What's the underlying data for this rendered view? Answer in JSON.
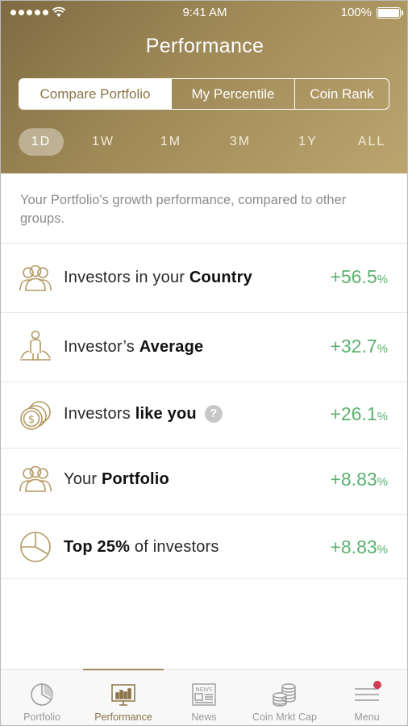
{
  "status_bar": {
    "time": "9:41 AM",
    "battery": "100%"
  },
  "header": {
    "title": "Performance",
    "segments": [
      "Compare Portfolio",
      "My Percentile",
      "Coin Rank"
    ],
    "active_segment": "Compare Portfolio",
    "ranges": [
      "1D",
      "1W",
      "1M",
      "3M",
      "1Y",
      "ALL"
    ],
    "active_range": "1D"
  },
  "description": "Your Portfolio's growth performance, compared to other groups.",
  "rows": [
    {
      "icon": "group-icon",
      "label_pre": "Investors in your ",
      "label_bold": "Country",
      "label_post": "",
      "value": "+56.5",
      "unit": "%"
    },
    {
      "icon": "average-investor-icon",
      "label_pre": "Investor’s ",
      "label_bold": "Average",
      "label_post": "",
      "value": "+32.7",
      "unit": "%"
    },
    {
      "icon": "coins-icon",
      "label_pre": "Investors ",
      "label_bold": "like you",
      "label_post": "",
      "help": "?",
      "value": "+26.1",
      "unit": "%"
    },
    {
      "icon": "group-icon",
      "label_pre": "Your ",
      "label_bold": "Portfolio",
      "label_post": "",
      "value": "+8.83",
      "unit": "%"
    },
    {
      "icon": "pie-chart-icon",
      "label_pre": "",
      "label_bold": "Top 25%",
      "label_post": " of investors",
      "value": "+8.83",
      "unit": "%"
    }
  ],
  "tabs": [
    {
      "label": "Portfolio",
      "icon": "pie-chart-icon"
    },
    {
      "label": "Performance",
      "icon": "bar-chart-icon"
    },
    {
      "label": "News",
      "icon": "newspaper-icon"
    },
    {
      "label": "Coin Mrkt Cap",
      "icon": "coin-stack-icon"
    },
    {
      "label": "Menu",
      "icon": "hamburger-icon"
    }
  ],
  "active_tab": "Performance",
  "colors": {
    "header_gold": "#a08a58",
    "positive": "#5ab26f",
    "badge": "#d33a55"
  }
}
